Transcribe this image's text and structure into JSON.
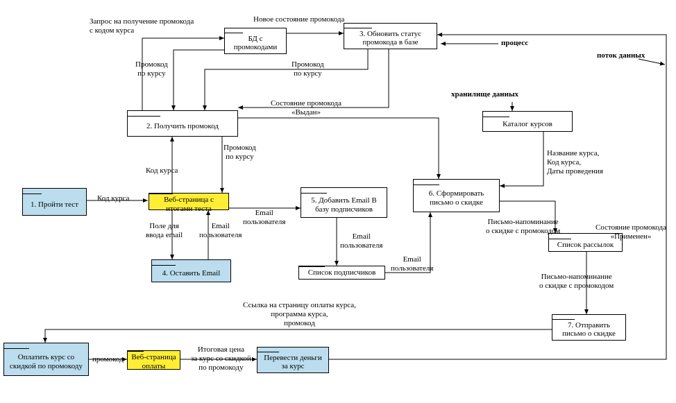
{
  "legend": {
    "process": "процесс",
    "dataflow": "поток данных",
    "datastore": "хранилище данных"
  },
  "boxes": {
    "n1_take_test": "1. Пройти тест",
    "n2_get_promo": "2. Получить\nпромокод",
    "n3_update_status": "3. Обновить статус\nпромокода в базе",
    "n4_leave_email": "4. Оставить Email",
    "n5_add_email": "5. Добавить Email В\nбазу подписчиков",
    "n6_form_letter": "6. Сформировать\nписьмо о скидке",
    "n7_send_letter": "7. Отправить\nписьмо о скидке",
    "db_promos": "БД с\nпромокодами",
    "page_results": "Веб-страница с\nитогами теста",
    "subscribers": "Список подписчиков",
    "catalog": "Каталог курсов",
    "mailing_list": "Список рассылок",
    "pay_course": "Оплатить курс со\nскидкой по\nпромокоду",
    "page_pay": "Веб-страница\nоплаты",
    "transfer_money": "Перевести деньги\nза курс"
  },
  "labels": {
    "l_request_promo": "Запрос на получение промокода\nс кодом курса",
    "l_new_state": "Новое состояние промокода",
    "l_promo_course1": "Промокод\nпо курсу",
    "l_state_issued": "Состояние промокода\n«Выдан»",
    "l_promo_course2": "Промокод\nпо курсу",
    "l_promo_course3": "Промокод\nпо курсу",
    "l_course_code1": "Код курса",
    "l_course_code2": "Код курса",
    "l_email_user1": "Email\nпользователя",
    "l_email_field": "Поле для\nввода email",
    "l_email_user2": "Email\nпользователя",
    "l_email_user3": "Email\nпользователя",
    "l_email_user4": "Email\nпользователя",
    "l_course_info": "Название курса,\nКод курса,\nДаты проведения",
    "l_letter_reminder1": "Письмо-напоминание\nо скидке с промокодом",
    "l_letter_reminder2": "Письмо-напоминание\nо скидке с промокодом",
    "l_state_applied": "Состояние промокода\n«Применен»",
    "l_link_program": "Ссылка на страницу оплаты курса,\nпрограмма курса,\nпромокод",
    "l_promocode": "промокод",
    "l_final_price": "Итоговая цена\nза курс со скидкой\nпо промокоду"
  }
}
